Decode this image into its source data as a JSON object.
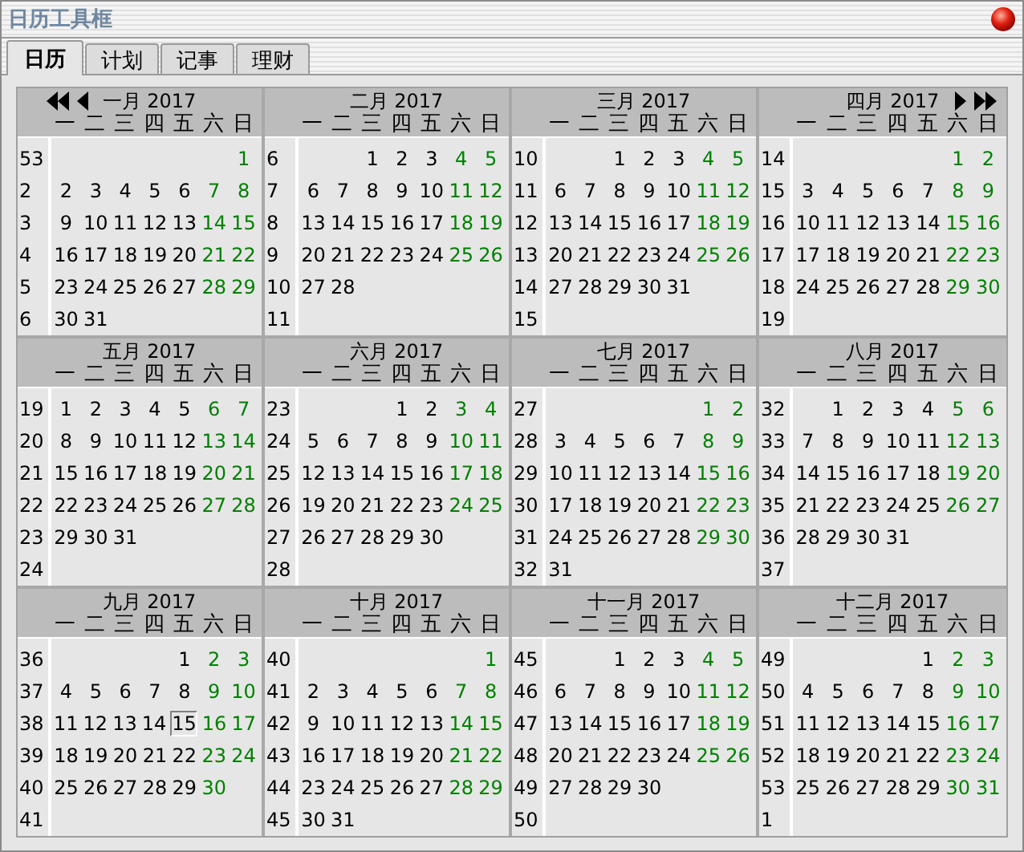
{
  "window": {
    "title": "日历工具框"
  },
  "tabs": [
    {
      "label": "日历",
      "selected": true
    },
    {
      "label": "计划",
      "selected": false
    },
    {
      "label": "记事",
      "selected": false
    },
    {
      "label": "理财",
      "selected": false
    }
  ],
  "months": [
    {
      "title": "一月 2017",
      "prev_nav": true,
      "weekdays": [
        "一",
        "二",
        "三",
        "四",
        "五",
        "六",
        "日"
      ],
      "weeks": [
        {
          "week": "53",
          "days": [
            "1"
          ]
        },
        {
          "week": "2",
          "days": [
            "2",
            "3",
            "4",
            "5",
            "6",
            "7",
            "8"
          ]
        },
        {
          "week": "3",
          "days": [
            "9",
            "10",
            "11",
            "12",
            "13",
            "14",
            "15"
          ]
        },
        {
          "week": "4",
          "days": [
            "16",
            "17",
            "18",
            "19",
            "20",
            "21",
            "22"
          ]
        },
        {
          "week": "5",
          "days": [
            "23",
            "24",
            "25",
            "26",
            "27",
            "28",
            "29"
          ]
        },
        {
          "week": "6",
          "days": [
            "30",
            "31"
          ]
        }
      ]
    },
    {
      "title": "二月 2017",
      "weekdays": [
        "一",
        "二",
        "三",
        "四",
        "五",
        "六",
        "日"
      ],
      "weeks": [
        {
          "week": "6",
          "days": [
            "1",
            "2",
            "3",
            "4",
            "5"
          ]
        },
        {
          "week": "7",
          "days": [
            "6",
            "7",
            "8",
            "9",
            "10",
            "11",
            "12"
          ]
        },
        {
          "week": "8",
          "days": [
            "13",
            "14",
            "15",
            "16",
            "17",
            "18",
            "19"
          ]
        },
        {
          "week": "9",
          "days": [
            "20",
            "21",
            "22",
            "23",
            "24",
            "25",
            "26"
          ]
        },
        {
          "week": "10",
          "days": [
            "27",
            "28"
          ]
        },
        {
          "week": "11"
        }
      ]
    },
    {
      "title": "三月 2017",
      "weekdays": [
        "一",
        "二",
        "三",
        "四",
        "五",
        "六",
        "日"
      ],
      "weeks": [
        {
          "week": "10",
          "days": [
            "1",
            "2",
            "3",
            "4",
            "5"
          ]
        },
        {
          "week": "11",
          "days": [
            "6",
            "7",
            "8",
            "9",
            "10",
            "11",
            "12"
          ]
        },
        {
          "week": "12",
          "days": [
            "13",
            "14",
            "15",
            "16",
            "17",
            "18",
            "19"
          ]
        },
        {
          "week": "13",
          "days": [
            "20",
            "21",
            "22",
            "23",
            "24",
            "25",
            "26"
          ]
        },
        {
          "week": "14",
          "days": [
            "27",
            "28",
            "29",
            "30",
            "31"
          ]
        },
        {
          "week": "15"
        }
      ]
    },
    {
      "title": "四月 2017",
      "next_nav": true,
      "weekdays": [
        "一",
        "二",
        "三",
        "四",
        "五",
        "六",
        "日"
      ],
      "weeks": [
        {
          "week": "14",
          "days": [
            "1",
            "2"
          ]
        },
        {
          "week": "15",
          "days": [
            "3",
            "4",
            "5",
            "6",
            "7",
            "8",
            "9"
          ]
        },
        {
          "week": "16",
          "days": [
            "10",
            "11",
            "12",
            "13",
            "14",
            "15",
            "16"
          ]
        },
        {
          "week": "17",
          "days": [
            "17",
            "18",
            "19",
            "20",
            "21",
            "22",
            "23"
          ]
        },
        {
          "week": "18",
          "days": [
            "24",
            "25",
            "26",
            "27",
            "28",
            "29",
            "30"
          ]
        },
        {
          "week": "19"
        }
      ]
    },
    {
      "title": "五月 2017",
      "weekdays": [
        "一",
        "二",
        "三",
        "四",
        "五",
        "六",
        "日"
      ],
      "weeks": [
        {
          "week": "19",
          "days": [
            "1",
            "2",
            "3",
            "4",
            "5",
            "6",
            "7"
          ]
        },
        {
          "week": "20",
          "days": [
            "8",
            "9",
            "10",
            "11",
            "12",
            "13",
            "14"
          ]
        },
        {
          "week": "21",
          "days": [
            "15",
            "16",
            "17",
            "18",
            "19",
            "20",
            "21"
          ]
        },
        {
          "week": "22",
          "days": [
            "22",
            "23",
            "24",
            "25",
            "26",
            "27",
            "28"
          ]
        },
        {
          "week": "23",
          "days": [
            "29",
            "30",
            "31"
          ]
        },
        {
          "week": "24"
        }
      ]
    },
    {
      "title": "六月 2017",
      "weekdays": [
        "一",
        "二",
        "三",
        "四",
        "五",
        "六",
        "日"
      ],
      "weeks": [
        {
          "week": "23",
          "days": [
            "1",
            "2",
            "3",
            "4"
          ]
        },
        {
          "week": "24",
          "days": [
            "5",
            "6",
            "7",
            "8",
            "9",
            "10",
            "11"
          ]
        },
        {
          "week": "25",
          "days": [
            "12",
            "13",
            "14",
            "15",
            "16",
            "17",
            "18"
          ]
        },
        {
          "week": "26",
          "days": [
            "19",
            "20",
            "21",
            "22",
            "23",
            "24",
            "25"
          ]
        },
        {
          "week": "27",
          "days": [
            "26",
            "27",
            "28",
            "29",
            "30"
          ]
        },
        {
          "week": "28"
        }
      ]
    },
    {
      "title": "七月 2017",
      "weekdays": [
        "一",
        "二",
        "三",
        "四",
        "五",
        "六",
        "日"
      ],
      "weeks": [
        {
          "week": "27",
          "days": [
            "1",
            "2"
          ]
        },
        {
          "week": "28",
          "days": [
            "3",
            "4",
            "5",
            "6",
            "7",
            "8",
            "9"
          ]
        },
        {
          "week": "29",
          "days": [
            "10",
            "11",
            "12",
            "13",
            "14",
            "15",
            "16"
          ]
        },
        {
          "week": "30",
          "days": [
            "17",
            "18",
            "19",
            "20",
            "21",
            "22",
            "23"
          ]
        },
        {
          "week": "31",
          "days": [
            "24",
            "25",
            "26",
            "27",
            "28",
            "29",
            "30"
          ]
        },
        {
          "week": "32",
          "days": [
            "31"
          ]
        }
      ]
    },
    {
      "title": "八月 2017",
      "weekdays": [
        "一",
        "二",
        "三",
        "四",
        "五",
        "六",
        "日"
      ],
      "weeks": [
        {
          "week": "32",
          "days": [
            "1",
            "2",
            "3",
            "4",
            "5",
            "6"
          ]
        },
        {
          "week": "33",
          "days": [
            "7",
            "8",
            "9",
            "10",
            "11",
            "12",
            "13"
          ]
        },
        {
          "week": "34",
          "days": [
            "14",
            "15",
            "16",
            "17",
            "18",
            "19",
            "20"
          ]
        },
        {
          "week": "35",
          "days": [
            "21",
            "22",
            "23",
            "24",
            "25",
            "26",
            "27"
          ]
        },
        {
          "week": "36",
          "days": [
            "28",
            "29",
            "30",
            "31"
          ]
        },
        {
          "week": "37"
        }
      ]
    },
    {
      "title": "九月 2017",
      "weekdays": [
        "一",
        "二",
        "三",
        "四",
        "五",
        "六",
        "日"
      ],
      "weeks": [
        {
          "week": "36",
          "days": [
            "1",
            "2",
            "3"
          ]
        },
        {
          "week": "37",
          "days": [
            "4",
            "5",
            "6",
            "7",
            "8",
            "9",
            "10"
          ]
        },
        {
          "week": "38",
          "days": [
            "11",
            "12",
            "13",
            "14",
            {
              "day": "15",
              "today": true
            },
            "16",
            "17"
          ]
        },
        {
          "week": "39",
          "days": [
            "18",
            "19",
            "20",
            "21",
            "22",
            "23",
            "24"
          ]
        },
        {
          "week": "40",
          "days": [
            "25",
            "26",
            "27",
            "28",
            "29",
            "30"
          ]
        },
        {
          "week": "41"
        }
      ]
    },
    {
      "title": "十月 2017",
      "weekdays": [
        "一",
        "二",
        "三",
        "四",
        "五",
        "六",
        "日"
      ],
      "weeks": [
        {
          "week": "40",
          "days": [
            "1"
          ]
        },
        {
          "week": "41",
          "days": [
            "2",
            "3",
            "4",
            "5",
            "6",
            "7",
            "8"
          ]
        },
        {
          "week": "42",
          "days": [
            "9",
            "10",
            "11",
            "12",
            "13",
            "14",
            "15"
          ]
        },
        {
          "week": "43",
          "days": [
            "16",
            "17",
            "18",
            "19",
            "20",
            "21",
            "22"
          ]
        },
        {
          "week": "44",
          "days": [
            "23",
            "24",
            "25",
            "26",
            "27",
            "28",
            "29"
          ]
        },
        {
          "week": "45",
          "days": [
            "30",
            "31"
          ]
        }
      ]
    },
    {
      "title": "十一月 2017",
      "weekdays": [
        "一",
        "二",
        "三",
        "四",
        "五",
        "六",
        "日"
      ],
      "weeks": [
        {
          "week": "45",
          "days": [
            "1",
            "2",
            "3",
            "4",
            "5"
          ]
        },
        {
          "week": "46",
          "days": [
            "6",
            "7",
            "8",
            "9",
            "10",
            "11",
            "12"
          ]
        },
        {
          "week": "47",
          "days": [
            "13",
            "14",
            "15",
            "16",
            "17",
            "18",
            "19"
          ]
        },
        {
          "week": "48",
          "days": [
            "20",
            "21",
            "22",
            "23",
            "24",
            "25",
            "26"
          ]
        },
        {
          "week": "49",
          "days": [
            "27",
            "28",
            "29",
            "30"
          ]
        },
        {
          "week": "50"
        }
      ]
    },
    {
      "title": "十二月 2017",
      "weekdays": [
        "一",
        "二",
        "三",
        "四",
        "五",
        "六",
        "日"
      ],
      "weeks": [
        {
          "week": "49",
          "days": [
            "1",
            "2",
            "3"
          ]
        },
        {
          "week": "50",
          "days": [
            "4",
            "5",
            "6",
            "7",
            "8",
            "9",
            "10"
          ]
        },
        {
          "week": "51",
          "days": [
            "11",
            "12",
            "13",
            "14",
            "15",
            "16",
            "17"
          ]
        },
        {
          "week": "52",
          "days": [
            "18",
            "19",
            "20",
            "21",
            "22",
            "23",
            "24"
          ]
        },
        {
          "week": "53",
          "days": [
            "25",
            "26",
            "27",
            "28",
            "29",
            "30",
            "31"
          ]
        },
        {
          "week": "1"
        }
      ]
    }
  ]
}
